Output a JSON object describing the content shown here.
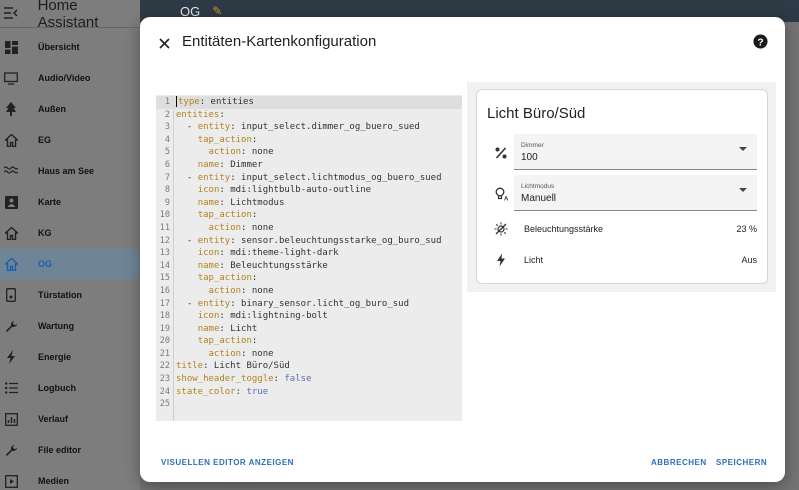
{
  "app": {
    "title": "Home Assistant"
  },
  "sidebar": {
    "items": [
      {
        "label": "Übersicht",
        "icon": "dashboard-icon"
      },
      {
        "label": "Audio/Video",
        "icon": "tv-icon"
      },
      {
        "label": "Außen",
        "icon": "tree-icon"
      },
      {
        "label": "EG",
        "icon": "home-icon"
      },
      {
        "label": "Haus am See",
        "icon": "waves-icon"
      },
      {
        "label": "Karte",
        "icon": "map-person-icon"
      },
      {
        "label": "KG",
        "icon": "home-icon"
      },
      {
        "label": "OG",
        "icon": "home-icon",
        "active": true
      },
      {
        "label": "Türstation",
        "icon": "doorbell-icon"
      },
      {
        "label": "Wartung",
        "icon": "wrench-icon"
      },
      {
        "label": "Energie",
        "icon": "lightning-icon"
      },
      {
        "label": "Logbuch",
        "icon": "list-icon"
      },
      {
        "label": "Verlauf",
        "icon": "chart-icon"
      },
      {
        "label": "File editor",
        "icon": "wrench-icon"
      },
      {
        "label": "Medien",
        "icon": "play-icon"
      }
    ]
  },
  "topbar": {
    "title": "OG"
  },
  "dialog": {
    "title": "Entitäten-Kartenkonfiguration",
    "footer": {
      "visual_editor": "VISUELLEN EDITOR ANZEIGEN",
      "cancel": "ABBRECHEN",
      "save": "SPEICHERN"
    }
  },
  "editor": {
    "lines": [
      [
        [
          "type",
          "k"
        ],
        [
          ": ",
          "v"
        ],
        [
          "entities",
          "v"
        ]
      ],
      [
        [
          "entities",
          "k"
        ],
        [
          ":",
          "v"
        ]
      ],
      [
        [
          "  - ",
          "v"
        ],
        [
          "entity",
          "k"
        ],
        [
          ": input_select.dimmer_og_buero_sued",
          "v"
        ]
      ],
      [
        [
          "    ",
          "v"
        ],
        [
          "tap_action",
          "k"
        ],
        [
          ":",
          "v"
        ]
      ],
      [
        [
          "      ",
          "v"
        ],
        [
          "action",
          "k"
        ],
        [
          ": none",
          "v"
        ]
      ],
      [
        [
          "    ",
          "v"
        ],
        [
          "name",
          "k"
        ],
        [
          ": Dimmer",
          "v"
        ]
      ],
      [
        [
          "  - ",
          "v"
        ],
        [
          "entity",
          "k"
        ],
        [
          ": input_select.lichtmodus_og_buero_sued",
          "v"
        ]
      ],
      [
        [
          "    ",
          "v"
        ],
        [
          "icon",
          "k"
        ],
        [
          ": mdi:lightbulb-auto-outline",
          "v"
        ]
      ],
      [
        [
          "    ",
          "v"
        ],
        [
          "name",
          "k"
        ],
        [
          ": Lichtmodus",
          "v"
        ]
      ],
      [
        [
          "    ",
          "v"
        ],
        [
          "tap_action",
          "k"
        ],
        [
          ":",
          "v"
        ]
      ],
      [
        [
          "      ",
          "v"
        ],
        [
          "action",
          "k"
        ],
        [
          ": none",
          "v"
        ]
      ],
      [
        [
          "  - ",
          "v"
        ],
        [
          "entity",
          "k"
        ],
        [
          ": sensor.beleuchtungsstarke_og_buro_sud",
          "v"
        ]
      ],
      [
        [
          "    ",
          "v"
        ],
        [
          "icon",
          "k"
        ],
        [
          ": mdi:theme-light-dark",
          "v"
        ]
      ],
      [
        [
          "    ",
          "v"
        ],
        [
          "name",
          "k"
        ],
        [
          ": Beleuchtungsstärke",
          "v"
        ]
      ],
      [
        [
          "    ",
          "v"
        ],
        [
          "tap_action",
          "k"
        ],
        [
          ":",
          "v"
        ]
      ],
      [
        [
          "      ",
          "v"
        ],
        [
          "action",
          "k"
        ],
        [
          ": none",
          "v"
        ]
      ],
      [
        [
          "  - ",
          "v"
        ],
        [
          "entity",
          "k"
        ],
        [
          ": binary_sensor.licht_og_buro_sud",
          "v"
        ]
      ],
      [
        [
          "    ",
          "v"
        ],
        [
          "icon",
          "k"
        ],
        [
          ": mdi:lightning-bolt",
          "v"
        ]
      ],
      [
        [
          "    ",
          "v"
        ],
        [
          "name",
          "k"
        ],
        [
          ": Licht",
          "v"
        ]
      ],
      [
        [
          "    ",
          "v"
        ],
        [
          "tap_action",
          "k"
        ],
        [
          ":",
          "v"
        ]
      ],
      [
        [
          "      ",
          "v"
        ],
        [
          "action",
          "k"
        ],
        [
          ": none",
          "v"
        ]
      ],
      [
        [
          "title",
          "k"
        ],
        [
          ": Licht Büro/Süd",
          "v"
        ]
      ],
      [
        [
          "show_header_toggle",
          "k"
        ],
        [
          ": ",
          "v"
        ],
        [
          "false",
          "b"
        ]
      ],
      [
        [
          "state_color",
          "k"
        ],
        [
          ": ",
          "v"
        ],
        [
          "true",
          "b"
        ]
      ],
      []
    ]
  },
  "preview": {
    "title": "Licht Büro/Süd",
    "dimmer": {
      "label": "Dimmer",
      "value": "100",
      "icon": "percent-icon"
    },
    "lichtmodus": {
      "label": "Lichtmodus",
      "value": "Manuell",
      "icon": "lightbulb-auto-outline-icon"
    },
    "beleuchtung": {
      "name": "Beleuchtungsstärke",
      "state": "23 %",
      "icon": "theme-light-dark-icon"
    },
    "licht": {
      "name": "Licht",
      "state": "Aus",
      "icon": "lightning-bolt-icon"
    }
  }
}
